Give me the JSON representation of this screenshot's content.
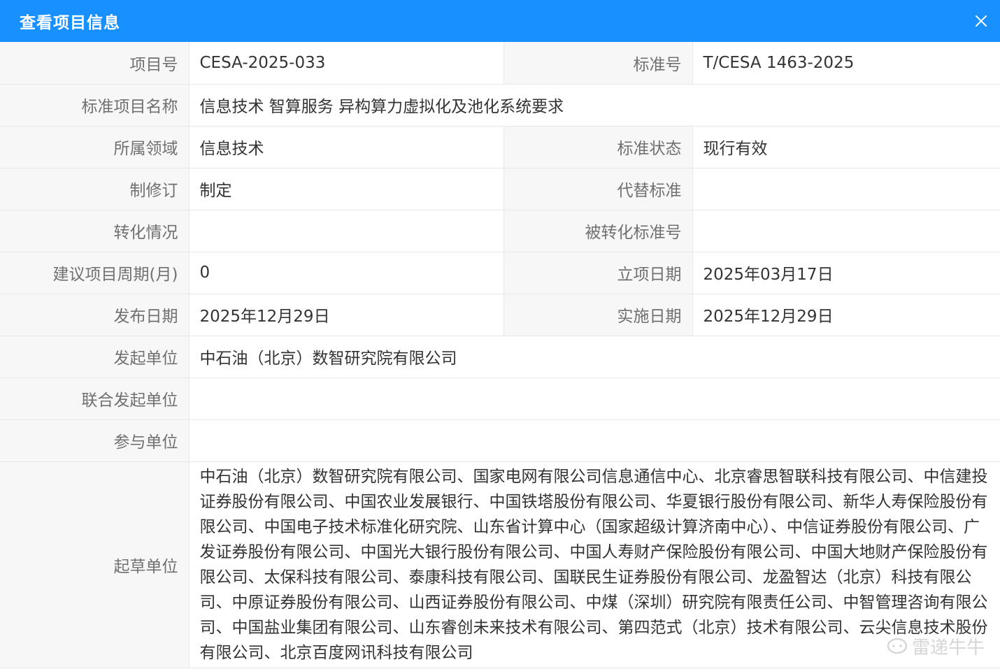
{
  "dialog": {
    "title": "查看项目信息"
  },
  "fields": {
    "project_no_label": "项目号",
    "project_no": "CESA-2025-033",
    "standard_no_label": "标准号",
    "standard_no": "T/CESA 1463-2025",
    "name_label": "标准项目名称",
    "name": "信息技术 智算服务 异构算力虚拟化及池化系统要求",
    "domain_label": "所属领域",
    "domain": "信息技术",
    "status_label": "标准状态",
    "status": "现行有效",
    "revision_label": "制修订",
    "revision": "制定",
    "replace_label": "代替标准",
    "replace": "",
    "conversion_label": "转化情况",
    "conversion": "",
    "converted_no_label": "被转化标准号",
    "converted_no": "",
    "period_label": "建议项目周期(月)",
    "period": "0",
    "approval_date_label": "立项日期",
    "approval_date": "2025年03月17日",
    "publish_date_label": "发布日期",
    "publish_date": "2025年12月29日",
    "impl_date_label": "实施日期",
    "impl_date": "2025年12月29日",
    "initiator_label": "发起单位",
    "initiator": "中石油（北京）数智研究院有限公司",
    "joint_initiator_label": "联合发起单位",
    "joint_initiator": "",
    "participants_label": "参与单位",
    "participants": "",
    "drafters_label": "起草单位",
    "drafters": "中石油（北京）数智研究院有限公司、国家电网有限公司信息通信中心、北京睿思智联科技有限公司、中信建投证券股份有限公司、中国农业发展银行、中国铁塔股份有限公司、华夏银行股份有限公司、新华人寿保险股份有限公司、中国电子技术标准化研究院、山东省计算中心（国家超级计算济南中心）、中信证券股份有限公司、广发证券股份有限公司、中国光大银行股份有限公司、中国人寿财产保险股份有限公司、中国大地财产保险股份有限公司、太保科技有限公司、泰康科技有限公司、国联民生证券股份有限公司、龙盈智达（北京）科技有限公司、中原证券股份有限公司、山西证券股份有限公司、中煤（深圳）研究院有限责任公司、中智管理咨询有限公司、中国盐业集团有限公司、山东睿创未来技术有限公司、第四范式（北京）技术有限公司、云尖信息技术股份有限公司、北京百度网讯科技有限公司"
  },
  "watermark": {
    "text": "雷递牛牛",
    "icon": "chat-bubble-icon"
  },
  "colors": {
    "header": "#1890ff",
    "label_bg": "#f7f7f7",
    "label_text": "#707070",
    "value_text": "#333333",
    "border": "#e8e8e8"
  }
}
